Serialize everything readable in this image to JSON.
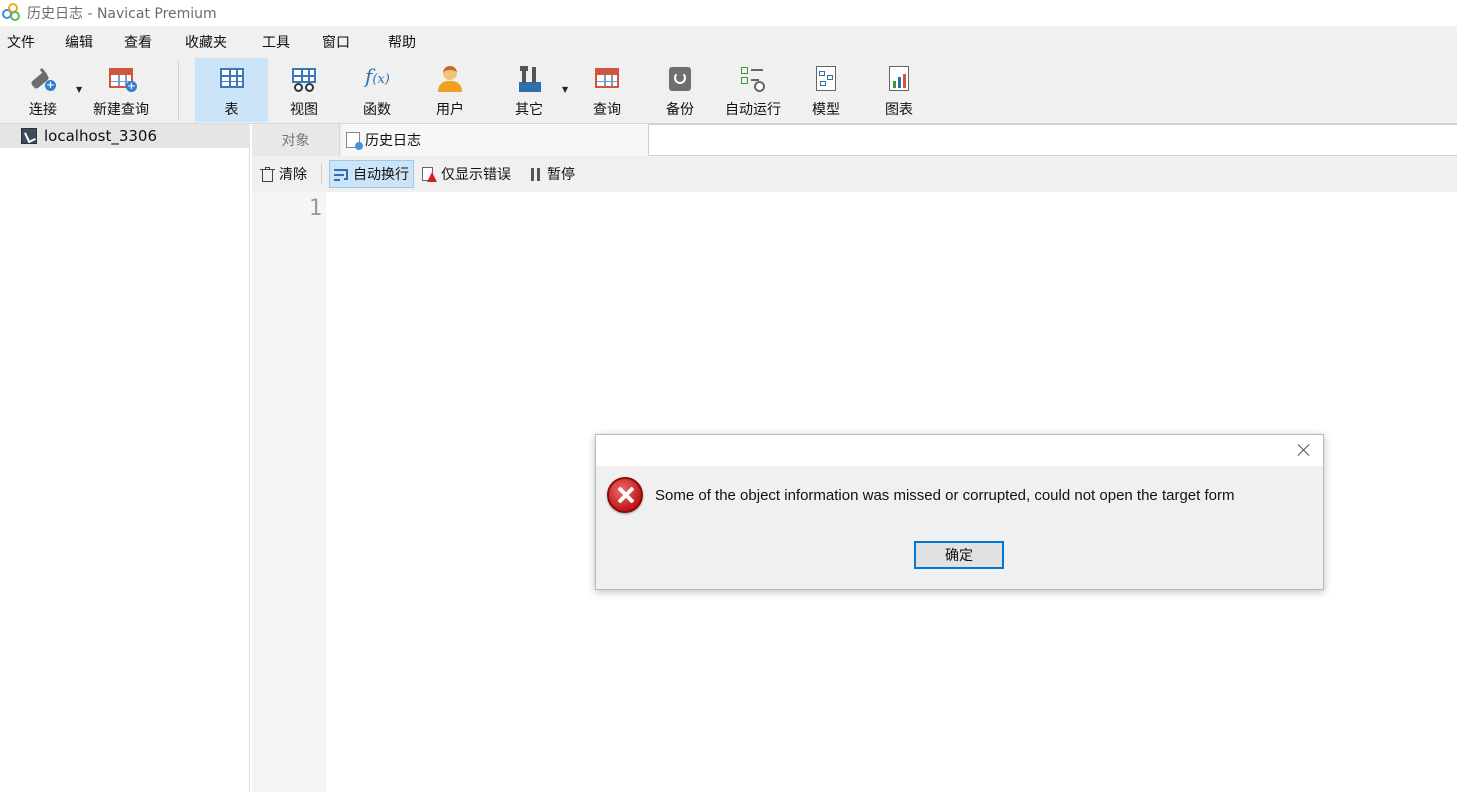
{
  "window": {
    "title": "历史日志 - Navicat Premium"
  },
  "menu": [
    "文件",
    "编辑",
    "查看",
    "收藏夹",
    "工具",
    "窗口",
    "帮助"
  ],
  "toolbar": {
    "connect": "连接",
    "new_query": "新建查询",
    "table": "表",
    "view": "视图",
    "function": "函数",
    "user": "用户",
    "other": "其它",
    "query": "查询",
    "backup": "备份",
    "automation": "自动运行",
    "model": "模型",
    "chart": "图表"
  },
  "sidebar": {
    "connection": "localhost_3306"
  },
  "tabs": {
    "objects": "对象",
    "history": "历史日志"
  },
  "subtoolbar": {
    "clear": "清除",
    "word_wrap": "自动换行",
    "errors_only": "仅显示错误",
    "pause": "暂停"
  },
  "editor": {
    "line_number": "1"
  },
  "dialog": {
    "message": "Some of the object information was missed or corrupted, could not open the target form",
    "ok": "确定"
  },
  "colors": {
    "accent": "#0078d7",
    "active_bg": "#cce4f7",
    "error": "#c01818"
  }
}
